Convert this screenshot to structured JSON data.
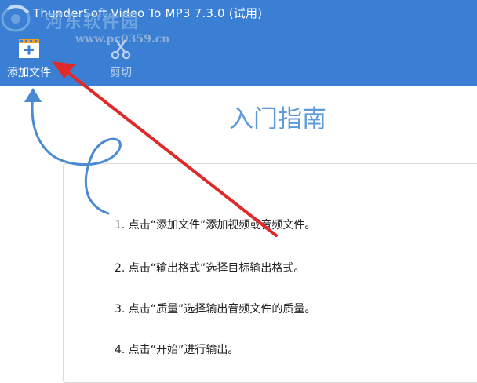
{
  "window": {
    "title": "ThunderSoft Video To MP3 7.3.0 (试用)"
  },
  "watermark": {
    "site_name": "河东软件园",
    "url": "www.pc0359.cn"
  },
  "toolbar": {
    "add_file": {
      "label": "添加文件",
      "icon": "add-video-icon",
      "enabled": true
    },
    "cut": {
      "label": "剪切",
      "icon": "scissors-icon",
      "enabled": false
    }
  },
  "guide": {
    "title": "入门指南",
    "steps": [
      {
        "text": "1. 点击“添加文件”添加视频或音频文件。"
      },
      {
        "text": "2. 点击“输出格式”选择目标输出格式。"
      },
      {
        "text": "3. 点击“质量”选择输出音频文件的质量。"
      },
      {
        "text": "4. 点击“开始”进行输出。"
      }
    ]
  },
  "annotations": {
    "blue_arrow_color": "#4a8ad2",
    "red_arrow_color": "#e02a2a"
  },
  "colors": {
    "accent": "#3a7fd4",
    "guide_title": "#5d9ad8"
  }
}
